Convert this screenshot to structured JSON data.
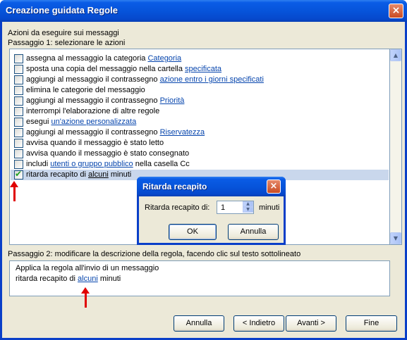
{
  "window": {
    "title": "Creazione guidata Regole",
    "close_glyph": "×"
  },
  "step1": {
    "heading": "Azioni da eseguire sui messaggi",
    "subheading": "Passaggio 1: selezionare le azioni",
    "items": [
      {
        "text": "assegna al messaggio la categoria ",
        "link": "Categoria",
        "after": "",
        "checked": false
      },
      {
        "text": "sposta una copia del messaggio nella cartella ",
        "link": "specificata",
        "after": "",
        "checked": false
      },
      {
        "text": "aggiungi al messaggio il contrassegno ",
        "link": "azione entro i giorni specificati",
        "after": "",
        "checked": false
      },
      {
        "text": "elimina le categorie del messaggio",
        "link": "",
        "after": "",
        "checked": false
      },
      {
        "text": "aggiungi al messaggio il contrassegno ",
        "link": "Priorità",
        "after": "",
        "checked": false
      },
      {
        "text": "interrompi l'elaborazione di altre regole",
        "link": "",
        "after": "",
        "checked": false
      },
      {
        "text": "esegui ",
        "link": "un'azione personalizzata",
        "after": "",
        "checked": false
      },
      {
        "text": "aggiungi al messaggio il contrassegno ",
        "link": "Riservatezza",
        "after": "",
        "checked": false
      },
      {
        "text": "avvisa quando il messaggio è stato letto",
        "link": "",
        "after": "",
        "checked": false
      },
      {
        "text": "avvisa quando il messaggio è stato consegnato",
        "link": "",
        "after": "",
        "checked": false
      },
      {
        "text": "includi ",
        "link": "utenti o gruppo pubblico",
        "after": " nella casella Cc",
        "checked": false
      },
      {
        "text": "ritarda recapito di ",
        "link": "alcuni",
        "after": " minuti",
        "checked": true
      }
    ]
  },
  "step2": {
    "heading": "Passaggio 2: modificare la descrizione della regola, facendo clic sul testo sottolineato",
    "line1": "Applica la regola all'invio di un messaggio",
    "line2_before": "ritarda recapito di ",
    "line2_link": "alcuni",
    "line2_after": " minuti"
  },
  "buttons": {
    "cancel": "Annulla",
    "back": "< Indietro",
    "next": "Avanti >",
    "finish": "Fine"
  },
  "dialog": {
    "title": "Ritarda recapito",
    "field_label": "Ritarda recapito di:",
    "value": "1",
    "unit": "minuti",
    "ok": "OK",
    "cancel": "Annulla"
  },
  "colors": {
    "link": "#0645ad",
    "arrow": "#e00000",
    "selection": "#c9d7ec",
    "titlebar": "#0653d9"
  }
}
